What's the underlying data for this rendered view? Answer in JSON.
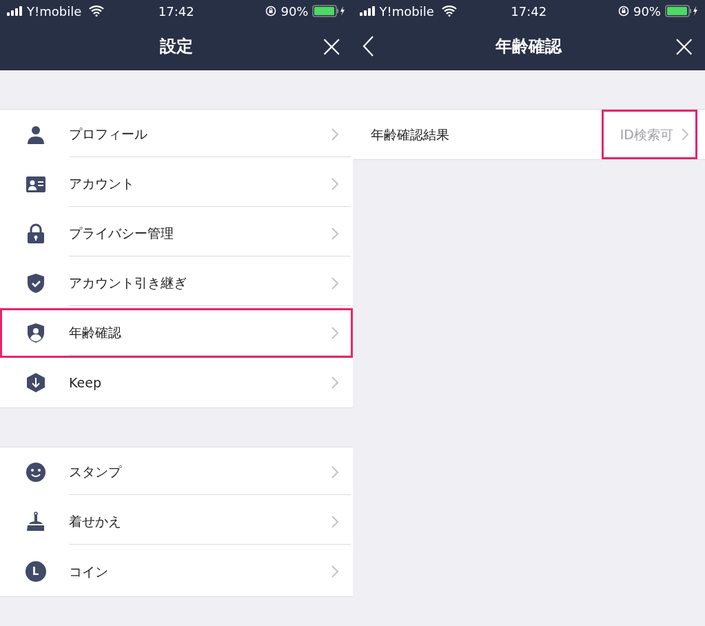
{
  "screens": [
    {
      "status_bar": {
        "carrier": "Y!mobile",
        "time": "17:42",
        "battery": "90%"
      },
      "nav": {
        "title": "設定",
        "back": false,
        "close": "×"
      },
      "groups": [
        [
          {
            "label": "プロフィール",
            "highlighted": false
          },
          {
            "label": "アカウント",
            "highlighted": false
          },
          {
            "label": "プライバシー管理",
            "highlighted": false
          },
          {
            "label": "アカウント引き継ぎ",
            "highlighted": false
          },
          {
            "label": "年齢確認",
            "highlighted": true
          },
          {
            "label": "Keep",
            "highlighted": false
          }
        ],
        [
          {
            "label": "スタンプ",
            "highlighted": false
          },
          {
            "label": "着せかえ",
            "highlighted": false
          },
          {
            "label": "コイン",
            "highlighted": false,
            "icon_text": "L"
          }
        ]
      ]
    },
    {
      "status_bar": {
        "carrier": "Y!mobile",
        "time": "17:42",
        "battery": "90%"
      },
      "nav": {
        "title": "年齢確認",
        "back": true,
        "close": "×"
      },
      "groups": [
        [
          {
            "label": "年齢確認結果",
            "value": "ID検索可",
            "highlighted": true
          }
        ]
      ]
    }
  ]
}
